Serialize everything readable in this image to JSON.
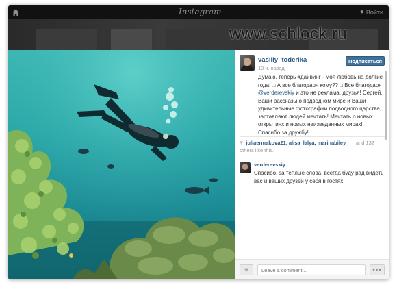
{
  "topbar": {
    "logo": "Instagram",
    "signin_label": "Войти",
    "home_icon": "home-icon",
    "user_icon": "user-icon"
  },
  "watermark": "www.schlock.ru",
  "post": {
    "username": "vasiliy_toderika",
    "time": "10 ч. назад",
    "follow_label": "Подписаться",
    "caption_part1": "Думаю, теперь #дайвинг - моя любовь на долгие года! ",
    "caption_part2": " А все благодаря кому?? ",
    "caption_part3": " Все благодаря ",
    "caption_mention": "@verderevskiy",
    "caption_part4": " и это не реклама, друзья! Сергей, Ваши рассказы о подводном мире и Ваши удивительные фотографии подводного царства, заставляют людей мечтать! Мечтать о новых открытиях и новых неизведанных мирах! Спасибо за дружбу!",
    "likes_names": "juliaermakova21, alisa_lalya, marinabiley___",
    "likes_rest": " and 132 others like this."
  },
  "comment": {
    "username": "verderevskiy",
    "text": "Спасибо, за теплые слова, всегда буду рад видеть вас и ваших друзей у себя в гостях."
  },
  "input": {
    "placeholder": "Leave a comment..."
  },
  "more_label": "•••",
  "colors": {
    "link": "#2b5a83",
    "follow_button": "#3f729b",
    "water": "#2aa7a8"
  }
}
